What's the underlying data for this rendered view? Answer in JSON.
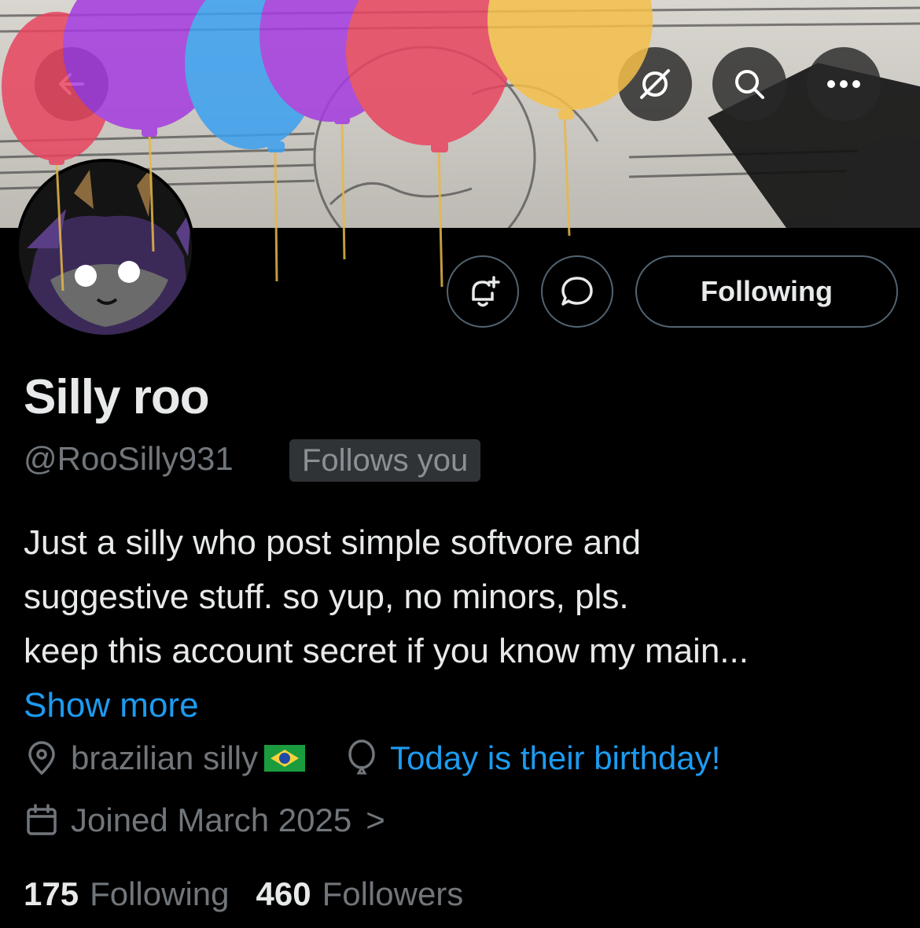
{
  "header": {
    "back_icon": "back-arrow-icon",
    "grok_icon": "slash-circle-icon",
    "search_icon": "search-icon",
    "more_icon": "more-dots-icon"
  },
  "actions": {
    "notify_icon": "bell-plus-icon",
    "message_icon": "message-bubble-icon",
    "follow_label": "Following"
  },
  "profile": {
    "name": "Silly roo",
    "handle": "@RooSilly931",
    "follows_you": "Follows you",
    "bio_lines": [
      "Just a silly who post simple softvore and",
      "suggestive stuff. so yup, no minors, pls.",
      "keep this account secret if you know my main..."
    ],
    "show_more": "Show more",
    "location": "brazilian silly",
    "location_flag": "🇧🇷",
    "birthday": "Today is their birthday!",
    "joined": "Joined March 2025",
    "joined_chevron": ">"
  },
  "stats": {
    "following_count": "175",
    "following_label": "Following",
    "followers_count": "460",
    "followers_label": "Followers"
  },
  "colors": {
    "accent": "#1d9bf0",
    "text": "#e7e9ea",
    "muted": "#71767b",
    "balloon_red": "#e8455f",
    "balloon_purple": "#a43be0",
    "balloon_blue": "#3aa0f0",
    "balloon_yellow": "#f5c04a"
  }
}
